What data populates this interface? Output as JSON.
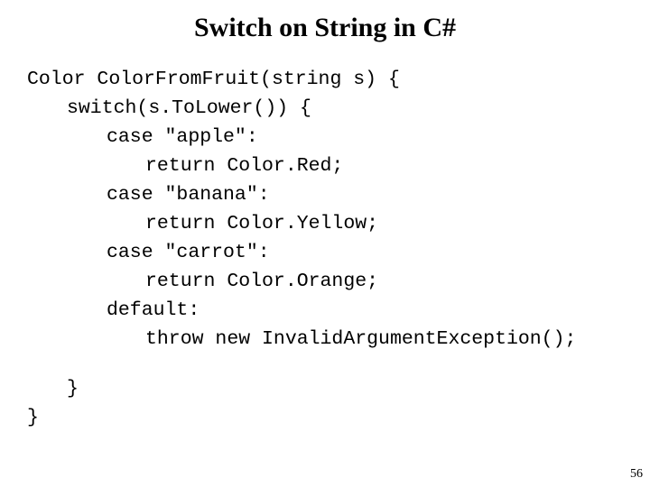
{
  "slide": {
    "title": "Switch on String in C#",
    "page_number": "56",
    "code_lines": [
      {
        "indent": 0,
        "text": "Color ColorFromFruit(string s) {"
      },
      {
        "indent": 1,
        "text": "switch(s.ToLower()) {"
      },
      {
        "indent": 2,
        "text": "case \"apple\":"
      },
      {
        "indent": 3,
        "text": "return Color.Red;"
      },
      {
        "indent": 2,
        "text": "case \"banana\":"
      },
      {
        "indent": 3,
        "text": "return Color.Yellow;"
      },
      {
        "indent": 2,
        "text": "case \"carrot\":"
      },
      {
        "indent": 3,
        "text": "return Color.Orange;"
      },
      {
        "indent": 2,
        "text": "default:"
      },
      {
        "indent": 3,
        "text": "throw new InvalidArgumentException();"
      },
      {
        "indent": 1,
        "text": "}"
      },
      {
        "indent": 0,
        "text": "}"
      }
    ]
  }
}
